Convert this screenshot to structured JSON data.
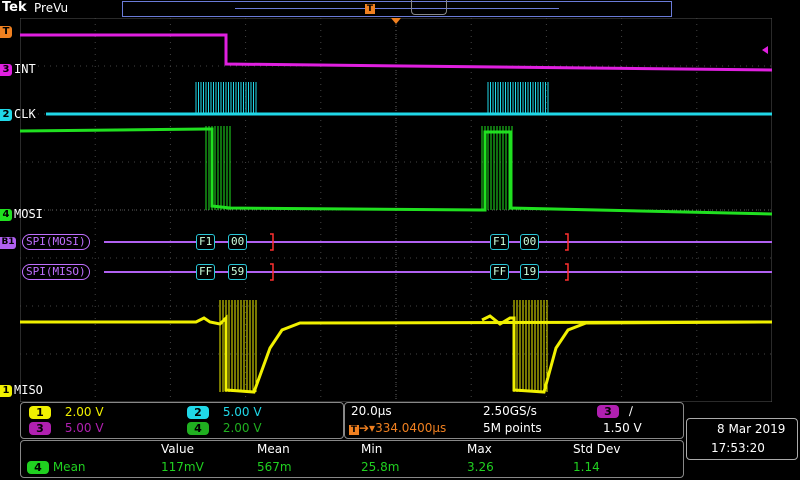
{
  "header": {
    "brand": "Tek",
    "mode": "PreVu",
    "trigger_marker": "T"
  },
  "channels": [
    {
      "num": "3",
      "label": "INT",
      "color": "#e020e0"
    },
    {
      "num": "2",
      "label": "CLK",
      "color": "#20d8e8"
    },
    {
      "num": "4",
      "label": "MOSI",
      "color": "#20e020"
    },
    {
      "num": "1",
      "label": "MISO",
      "color": "#f0f000"
    }
  ],
  "buses": [
    {
      "num": "B1",
      "name": "SPI(MOSI)",
      "packets": [
        [
          "F1",
          "00"
        ],
        [
          "F1",
          "00"
        ]
      ]
    },
    {
      "num": "",
      "name": "SPI(MISO)",
      "packets": [
        [
          "FF",
          "59"
        ],
        [
          "FF",
          "19"
        ]
      ]
    }
  ],
  "scale": {
    "ch1": {
      "num": "1",
      "value": "2.00 V",
      "color": "#f0f000"
    },
    "ch2": {
      "num": "2",
      "value": "5.00 V",
      "color": "#20d8e8"
    },
    "ch3": {
      "num": "3",
      "value": "5.00 V",
      "color": "#e020e0"
    },
    "ch4": {
      "num": "4",
      "value": "2.00 V",
      "color": "#20e020"
    }
  },
  "timebase": {
    "horizontal": "20.0µs",
    "sample_rate": "2.50GS/s",
    "trigger_position": "334.0400µs",
    "record_length": "5M points",
    "trigger_source": "3",
    "trigger_slope": "∕",
    "trigger_level": "1.50 V"
  },
  "datetime": {
    "date": "8 Mar  2019",
    "time": "17:53:20"
  },
  "measurement": {
    "headers": [
      "Value",
      "Mean",
      "Min",
      "Max",
      "Std Dev"
    ],
    "source": "4",
    "name": "Mean",
    "values": [
      "117mV",
      "567m",
      "25.8m",
      "3.26",
      "1.14"
    ]
  }
}
